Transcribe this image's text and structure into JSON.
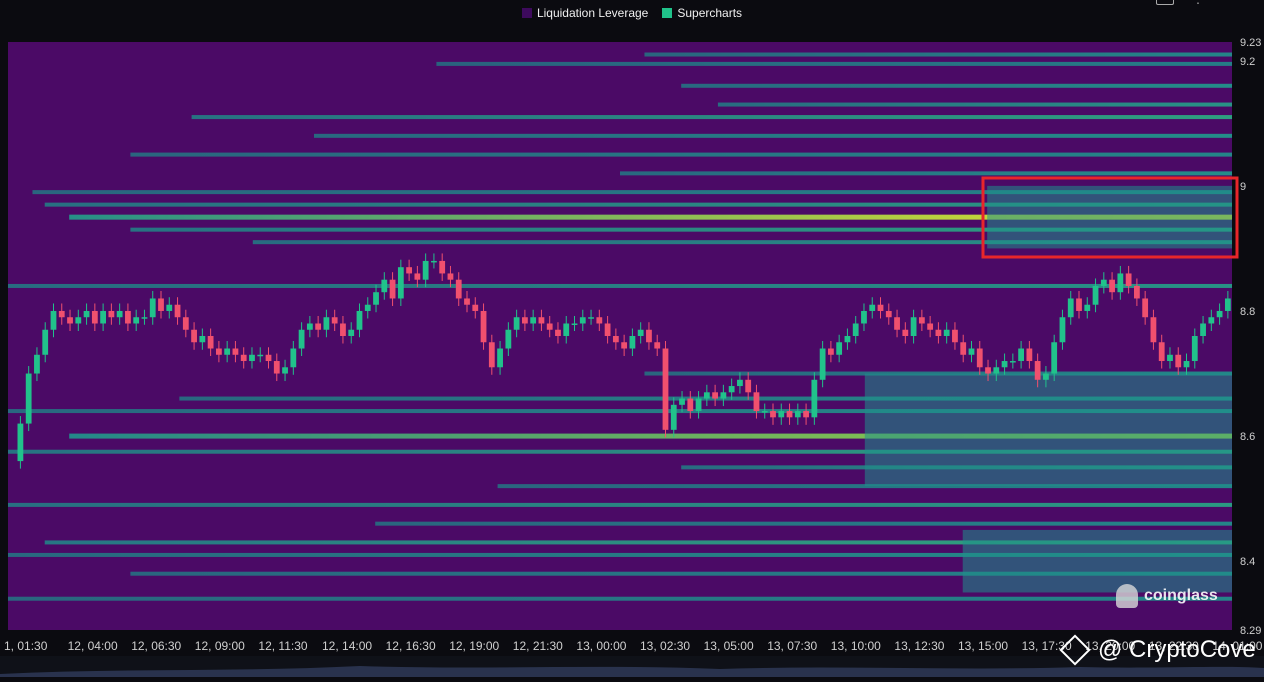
{
  "legend": {
    "items": [
      {
        "label": "Liquidation Leverage",
        "color": "#3d0a5c"
      },
      {
        "label": "Supercharts",
        "color": "#20c38a"
      }
    ]
  },
  "watermark": {
    "coinglass": "coinglass",
    "cryptocove": "@ CryptoCove"
  },
  "colors": {
    "background": "#4b0a66",
    "candle_up": "#21c28b",
    "candle_down": "#f0506e",
    "highlight_box": "#e8262a",
    "liquidation_max": "#f3f323"
  },
  "chart_data": {
    "type": "heatmap",
    "title": "",
    "xlabel": "",
    "ylabel": "",
    "y_axis": {
      "ticks": [
        "9.23",
        "9.2",
        "9",
        "8.8",
        "8.6",
        "8.4",
        "8.29"
      ],
      "range": [
        8.29,
        9.23
      ]
    },
    "x_axis": {
      "ticks": [
        "1, 01:30",
        "12, 04:00",
        "12, 06:30",
        "12, 09:00",
        "12, 11:30",
        "12, 14:00",
        "12, 16:30",
        "12, 19:00",
        "12, 21:30",
        "13, 00:00",
        "13, 02:30",
        "13, 05:00",
        "13, 07:30",
        "13, 10:00",
        "13, 12:30",
        "13, 15:00",
        "13, 17:30",
        "13, 20:00",
        "13, 22:30",
        "14, 01:00"
      ]
    },
    "liquidation_levels": [
      {
        "price": 9.21,
        "start": 0.52,
        "intensity": 0.35
      },
      {
        "price": 9.195,
        "start": 0.35,
        "intensity": 0.3
      },
      {
        "price": 9.16,
        "start": 0.55,
        "intensity": 0.4
      },
      {
        "price": 9.13,
        "start": 0.58,
        "intensity": 0.45
      },
      {
        "price": 9.11,
        "start": 0.15,
        "intensity": 0.55
      },
      {
        "price": 9.08,
        "start": 0.25,
        "intensity": 0.4
      },
      {
        "price": 9.05,
        "start": 0.1,
        "intensity": 0.35
      },
      {
        "price": 9.02,
        "start": 0.5,
        "intensity": 0.4
      },
      {
        "price": 8.99,
        "start": 0.02,
        "intensity": 0.35
      },
      {
        "price": 8.97,
        "start": 0.03,
        "intensity": 0.5
      },
      {
        "price": 8.95,
        "start": 0.05,
        "intensity": 1.0
      },
      {
        "price": 8.93,
        "start": 0.1,
        "intensity": 0.55
      },
      {
        "price": 8.91,
        "start": 0.2,
        "intensity": 0.45
      },
      {
        "price": 8.84,
        "start": 0.0,
        "intensity": 0.45
      },
      {
        "price": 8.7,
        "start": 0.52,
        "intensity": 0.35
      },
      {
        "price": 8.66,
        "start": 0.14,
        "intensity": 0.4
      },
      {
        "price": 8.64,
        "start": 0.0,
        "intensity": 0.4
      },
      {
        "price": 8.6,
        "start": 0.05,
        "intensity": 0.85
      },
      {
        "price": 8.575,
        "start": 0.0,
        "intensity": 0.55
      },
      {
        "price": 8.55,
        "start": 0.55,
        "intensity": 0.45
      },
      {
        "price": 8.52,
        "start": 0.4,
        "intensity": 0.35
      },
      {
        "price": 8.49,
        "start": 0.0,
        "intensity": 0.5
      },
      {
        "price": 8.46,
        "start": 0.3,
        "intensity": 0.35
      },
      {
        "price": 8.43,
        "start": 0.03,
        "intensity": 0.6
      },
      {
        "price": 8.41,
        "start": 0.0,
        "intensity": 0.4
      },
      {
        "price": 8.38,
        "start": 0.1,
        "intensity": 0.35
      },
      {
        "price": 8.34,
        "start": 0.0,
        "intensity": 0.35
      }
    ],
    "price_series": [
      8.56,
      8.62,
      8.7,
      8.73,
      8.77,
      8.8,
      8.79,
      8.78,
      8.79,
      8.8,
      8.78,
      8.8,
      8.79,
      8.8,
      8.78,
      8.79,
      8.79,
      8.82,
      8.8,
      8.81,
      8.79,
      8.77,
      8.75,
      8.76,
      8.74,
      8.73,
      8.74,
      8.73,
      8.72,
      8.73,
      8.73,
      8.72,
      8.7,
      8.71,
      8.74,
      8.77,
      8.78,
      8.77,
      8.79,
      8.78,
      8.76,
      8.77,
      8.8,
      8.81,
      8.83,
      8.85,
      8.82,
      8.87,
      8.86,
      8.85,
      8.88,
      8.88,
      8.86,
      8.85,
      8.82,
      8.81,
      8.8,
      8.75,
      8.71,
      8.74,
      8.77,
      8.79,
      8.78,
      8.79,
      8.78,
      8.77,
      8.76,
      8.78,
      8.78,
      8.79,
      8.79,
      8.78,
      8.76,
      8.75,
      8.74,
      8.76,
      8.77,
      8.75,
      8.74,
      8.61,
      8.65,
      8.66,
      8.64,
      8.66,
      8.67,
      8.66,
      8.67,
      8.68,
      8.69,
      8.67,
      8.64,
      8.64,
      8.63,
      8.64,
      8.63,
      8.64,
      8.63,
      8.69,
      8.74,
      8.73,
      8.75,
      8.76,
      8.78,
      8.8,
      8.81,
      8.8,
      8.79,
      8.77,
      8.76,
      8.79,
      8.78,
      8.77,
      8.76,
      8.77,
      8.75,
      8.73,
      8.74,
      8.71,
      8.7,
      8.71,
      8.72,
      8.72,
      8.74,
      8.72,
      8.69,
      8.7,
      8.75,
      8.79,
      8.82,
      8.8,
      8.81,
      8.84,
      8.85,
      8.83,
      8.86,
      8.84,
      8.82,
      8.79,
      8.75,
      8.72,
      8.73,
      8.71,
      8.72,
      8.76,
      8.78,
      8.79,
      8.8,
      8.82
    ]
  }
}
